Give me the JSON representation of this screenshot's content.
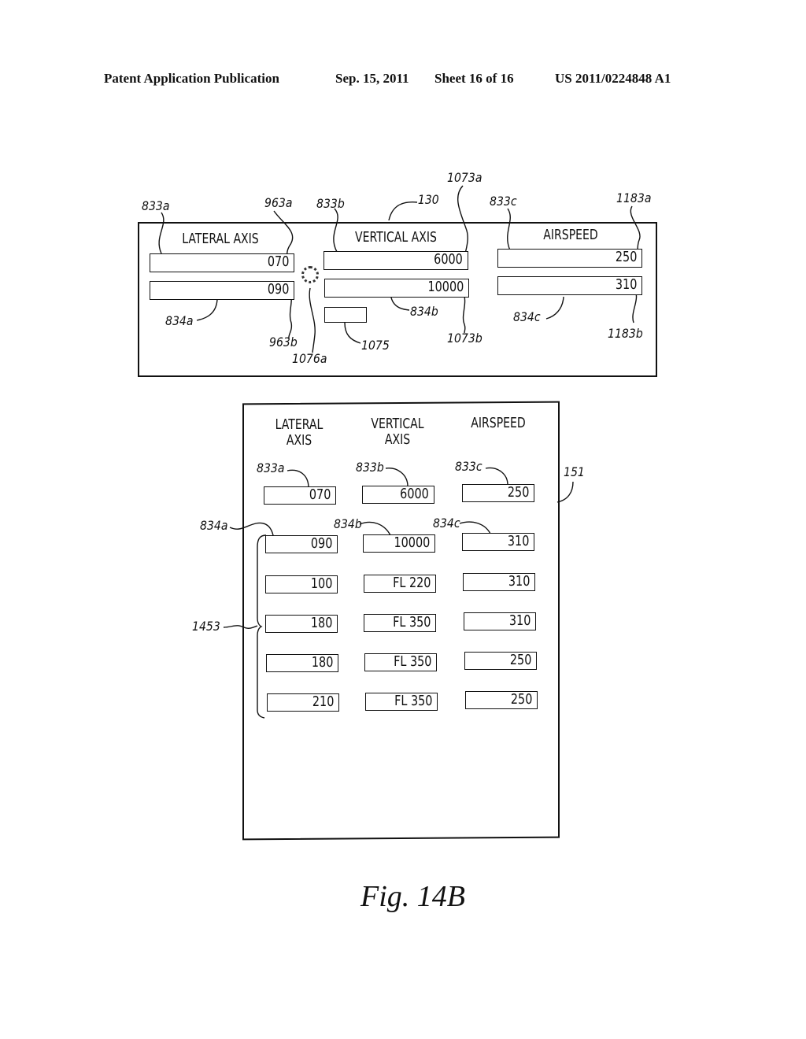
{
  "header": {
    "publication": "Patent Application Publication",
    "date": "Sep. 15, 2011",
    "sheet": "Sheet 16 of 16",
    "number": "US 2011/0224848 A1"
  },
  "top_panel": {
    "ref": "130",
    "columns": [
      {
        "title": "LATERAL AXIS",
        "current_ref": "833a",
        "current_value": "070",
        "current_value_ref": "963a",
        "next_ref": "834a",
        "next_value": "090",
        "next_value_ref": "963b"
      },
      {
        "title": "VERTICAL AXIS",
        "current_ref": "833b",
        "current_value": "6000",
        "current_value_ref": "1073a",
        "next_ref": "834b",
        "next_value": "10000",
        "next_value_ref": "1073b"
      },
      {
        "title": "AIRSPEED",
        "current_ref": "833c",
        "current_value": "250",
        "current_value_ref": "1183a",
        "next_ref": "834c",
        "next_value": "310",
        "next_value_ref": "1183b"
      }
    ],
    "knob_ref": "1076a",
    "small_box_ref": "1075"
  },
  "bottom_panel": {
    "ref": "151",
    "column_titles": [
      [
        "LATERAL",
        "AXIS"
      ],
      [
        "VERTICAL",
        "AXIS"
      ],
      [
        "AIRSPEED"
      ]
    ],
    "current_refs": [
      "833a",
      "833b",
      "833c"
    ],
    "current_values": [
      "070",
      "6000",
      "250"
    ],
    "next_refs": [
      "834a",
      "834b",
      "834c"
    ],
    "bracket_ref": "1453",
    "rows": [
      [
        "090",
        "10000",
        "310"
      ],
      [
        "100",
        "FL 220",
        "310"
      ],
      [
        "180",
        "FL 350",
        "310"
      ],
      [
        "180",
        "FL 350",
        "250"
      ],
      [
        "210",
        "FL 350",
        "250"
      ]
    ]
  },
  "figure_label": "Fig.  14B"
}
